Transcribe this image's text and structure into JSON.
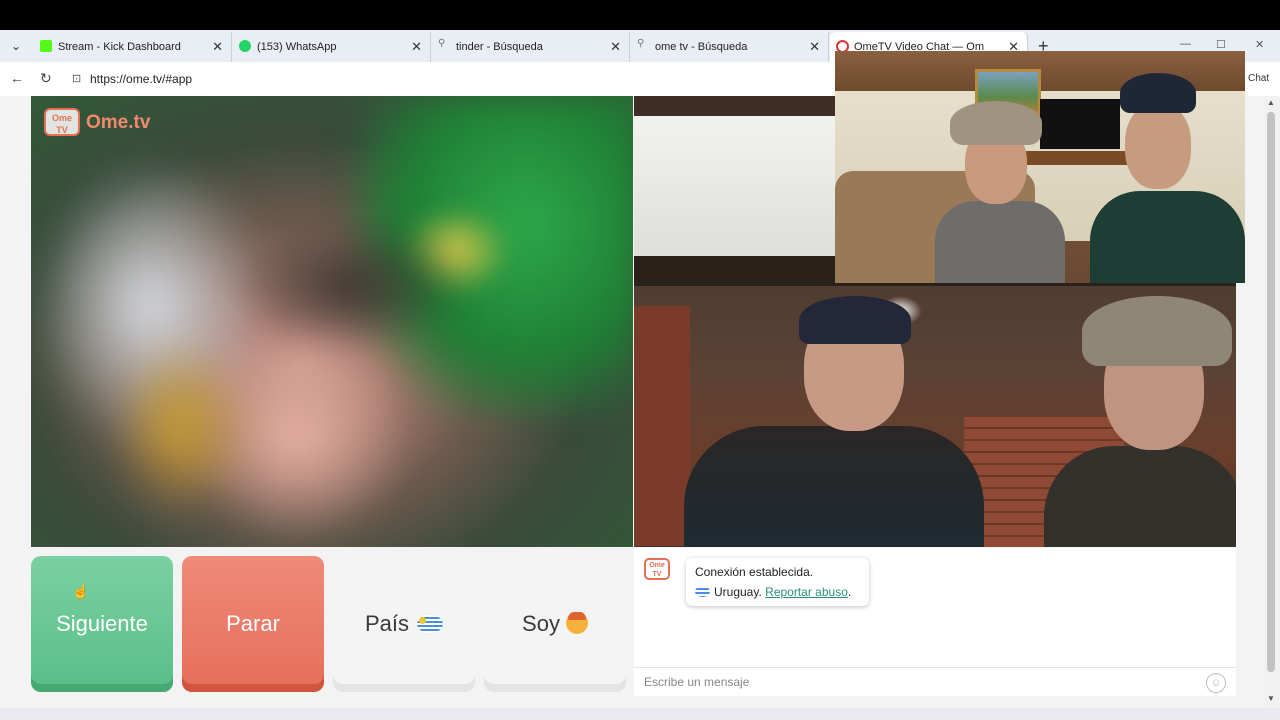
{
  "browser": {
    "tabs": [
      {
        "label": "Stream - Kick Dashboard",
        "icon": "kick-icon",
        "color": "#53fc18"
      },
      {
        "label": "(153) WhatsApp",
        "icon": "whatsapp-icon",
        "color": "#25d366"
      },
      {
        "label": "tinder - Búsqueda",
        "icon": "search-icon"
      },
      {
        "label": "ome tv - Búsqueda",
        "icon": "search-icon"
      },
      {
        "label": "OmeTV Video Chat — Omegle",
        "icon": "recording-icon",
        "active": true
      }
    ],
    "url": "https://ome.tv/#app",
    "side_label": "Chat"
  },
  "app": {
    "logo_badge": "Ome TV",
    "logo_text": "Ome.tv",
    "buttons": {
      "next": "Siguiente",
      "stop": "Parar",
      "country": "País",
      "gender": "Soy"
    },
    "chat": {
      "logo_badge": "Ome TV",
      "status": "Conexión establecida.",
      "country": "Uruguay.",
      "report_link": "Reportar abuso",
      "report_suffix": ".",
      "input_placeholder": "Escribe un mensaje"
    }
  },
  "colors": {
    "next": "#59be88",
    "stop": "#e56e5a",
    "brand": "#e86e55",
    "link": "#2b8f7b"
  }
}
